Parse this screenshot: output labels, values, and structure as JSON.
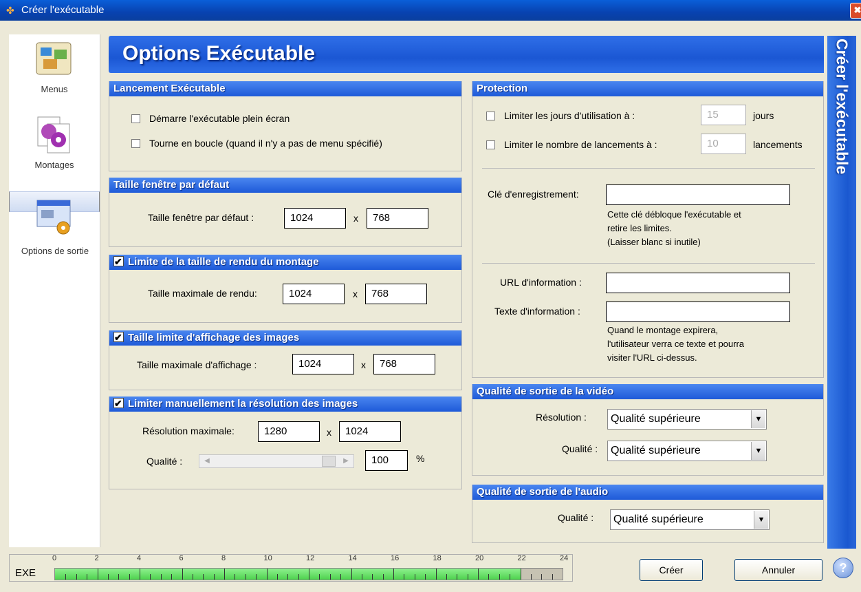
{
  "window": {
    "title": "Créer l'exécutable",
    "close_label": "✖"
  },
  "nav": [
    {
      "label": "Menus",
      "icon": "menus-icon"
    },
    {
      "label": "Montages",
      "icon": "montages-icon"
    },
    {
      "label": "Options de sortie",
      "icon": "output-options-icon"
    }
  ],
  "header": {
    "title": "Options Exécutable"
  },
  "side_banner": {
    "text": "Créer l'exécutable"
  },
  "launch": {
    "title": "Lancement Exécutable",
    "fullscreen_label": "Démarre l'exécutable plein écran",
    "loop_label": "Tourne en boucle (quand il n'y a pas de menu spécifié)"
  },
  "window_size": {
    "title": "Taille fenêtre par défaut",
    "label": "Taille fenêtre par défaut :",
    "width": "1024",
    "x": "x",
    "height": "768"
  },
  "render_limit": {
    "title": "Limite de la taille de rendu du montage",
    "label": "Taille maximale de rendu:",
    "width": "1024",
    "x": "x",
    "height": "768"
  },
  "display_limit": {
    "title": "Taille limite d'affichage des images",
    "label": "Taille maximale d'affichage :",
    "width": "1024",
    "x": "x",
    "height": "768"
  },
  "resolution_limit": {
    "title": "Limiter manuellement la résolution des images",
    "label": "Résolution maximale:",
    "width": "1280",
    "x": "x",
    "height": "1024",
    "quality_label": "Qualité :",
    "quality_value": "100",
    "quality_unit": "%"
  },
  "protection": {
    "title": "Protection",
    "days_label": "Limiter les jours d'utilisation à :",
    "days_value": "15",
    "days_unit": "jours",
    "launches_label": "Limiter le nombre de lancements à :",
    "launches_value": "10",
    "launches_unit": "lancements",
    "key_label": "Clé d'enregistrement:",
    "key_value": "",
    "key_help_1": "Cette clé débloque l'exécutable et",
    "key_help_2": "retire les limites.",
    "key_help_3": "(Laisser blanc si inutile)",
    "url_label": "URL d'information :",
    "url_value": "",
    "text_label": "Texte d'information :",
    "text_value": "",
    "info_help_1": "Quand le montage expirera,",
    "info_help_2": "l'utilisateur verra ce texte et pourra",
    "info_help_3": "visiter l'URL ci-dessus."
  },
  "video_quality": {
    "title": "Qualité de sortie de la vidéo",
    "resolution_label": "Résolution :",
    "resolution_value": "Qualité supérieure",
    "quality_label": "Qualité :",
    "quality_value": "Qualité supérieure"
  },
  "audio_quality": {
    "title": "Qualité de sortie de l'audio",
    "quality_label": "Qualité :",
    "quality_value": "Qualité supérieure"
  },
  "footer": {
    "exe_label": "EXE",
    "ticks": [
      "0",
      "2",
      "4",
      "6",
      "8",
      "10",
      "12",
      "14",
      "16",
      "18",
      "20",
      "22",
      "24"
    ],
    "fill_value": 22,
    "max_value": 24,
    "create_label": "Créer",
    "cancel_label": "Annuler",
    "help_label": "?"
  }
}
